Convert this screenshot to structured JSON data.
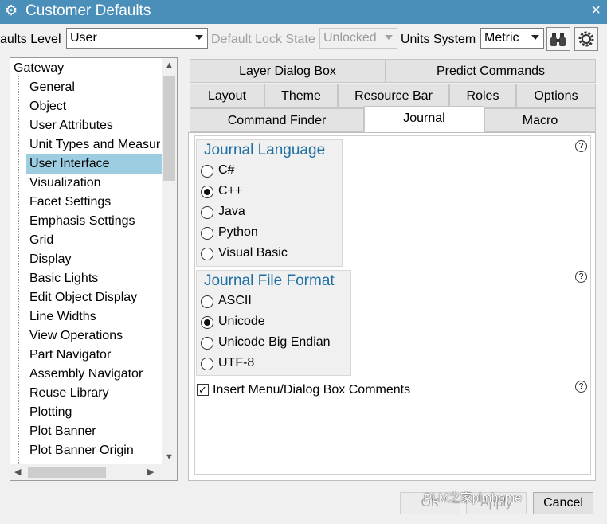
{
  "window": {
    "title": "Customer Defaults",
    "close_icon": "×"
  },
  "toolbar": {
    "level_label": "aults Level",
    "level_value": "User",
    "lock_label": "Default Lock State",
    "lock_value": "Unlocked",
    "units_label": "Units System",
    "units_value": "Metric"
  },
  "tree": {
    "root": "Gateway",
    "items": [
      "General",
      "Object",
      "User Attributes",
      "Unit Types and Measur",
      "User Interface",
      "Visualization",
      "Facet Settings",
      "Emphasis Settings",
      "Grid",
      "Display",
      "Basic Lights",
      "Edit Object Display",
      "Line Widths",
      "View Operations",
      "Part Navigator",
      "Assembly Navigator",
      "Reuse Library",
      "Plotting",
      "Plot Banner",
      "Plot Banner Origin"
    ],
    "selected": "User Interface"
  },
  "tabs": {
    "row1": [
      "Layer Dialog Box",
      "Predict Commands"
    ],
    "row2": [
      "Layout",
      "Theme",
      "Resource Bar",
      "Roles",
      "Options"
    ],
    "row3": [
      "Command Finder",
      "Journal",
      "Macro"
    ],
    "active": "Journal"
  },
  "journal_language": {
    "title": "Journal Language",
    "options": [
      "C#",
      "C++",
      "Java",
      "Python",
      "Visual Basic"
    ],
    "selected": "C++"
  },
  "journal_file_format": {
    "title": "Journal File Format",
    "options": [
      "ASCII",
      "Unicode",
      "Unicode Big Endian",
      "UTF-8"
    ],
    "selected": "Unicode"
  },
  "insert_comments": {
    "label": "Insert Menu/Dialog Box Comments",
    "checked": true
  },
  "help_icon": "?",
  "buttons": {
    "ok": "OK",
    "apply": "Apply",
    "cancel": "Cancel"
  },
  "watermark": "PLM之家plmhome"
}
